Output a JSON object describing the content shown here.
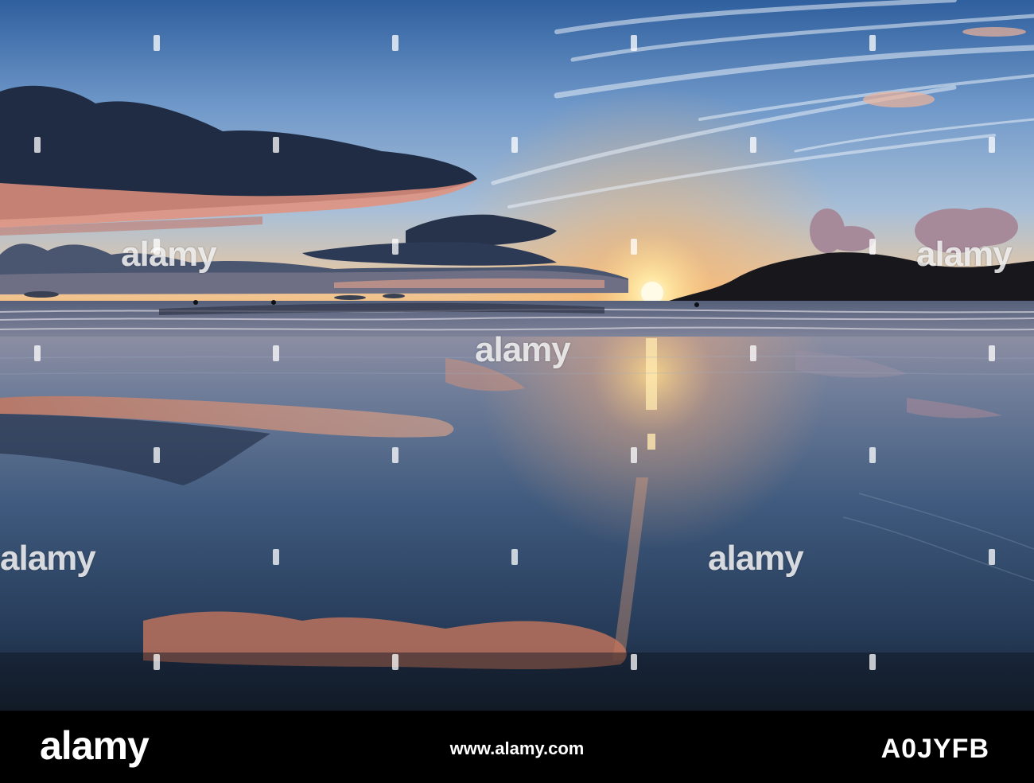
{
  "image": {
    "subject": "Sunset over a wet sandy beach reflecting a cloudy sky, with a dark headland on the right and distant surfers in the waves",
    "colors": {
      "sky_top": "#3c6aa6",
      "sky_mid": "#8fb3d8",
      "horizon_glow": "#ffb35a",
      "sun": "#fff3c4",
      "cloud_dark": "#25324a",
      "cloud_pink": "#e89a8a",
      "sand_reflection": "#3b5575",
      "headland": "#16161c"
    }
  },
  "watermark": {
    "word": "alamy",
    "icon": "dot-marker-icon"
  },
  "footer": {
    "logo": "alamy",
    "code": "A0JYFB",
    "url": "www.alamy.com"
  }
}
